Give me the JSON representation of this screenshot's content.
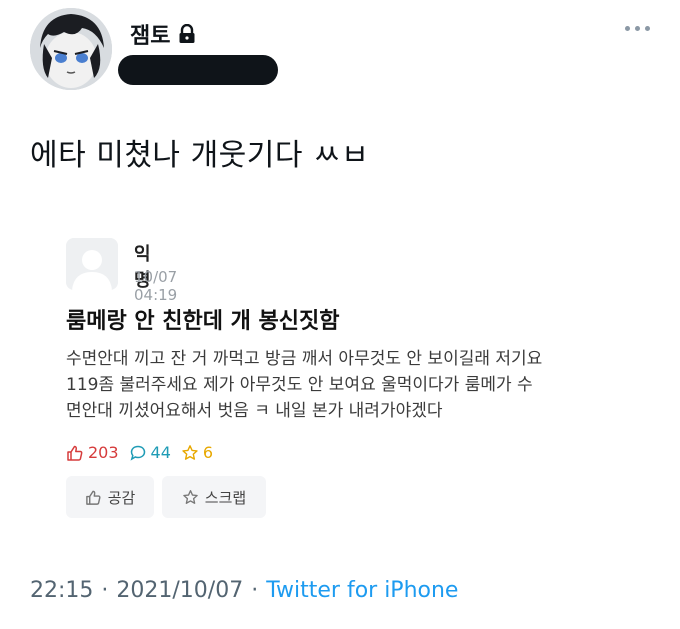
{
  "tweet": {
    "author_name": "잼토",
    "text": "에타 미쳤나 개웃기다 ㅆㅂ",
    "time": "22:15",
    "date": "2021/10/07",
    "source": "Twitter for iPhone",
    "separator": "·"
  },
  "embed": {
    "author": "익명",
    "time": "10/07 04:19",
    "title": "룸메랑 안 친한데 개 봉신짓함",
    "body_lines": [
      "수면안대 끼고 잔 거 까먹고 방금 깨서 아무것도 안 보이길래 저기요",
      "119좀 불러주세요 제가 아무것도 안 보여요 울먹이다가 룸메가 수",
      "면안대 끼셨어요해서 벗음 ㅋ 내일 본가 내려가야겠다"
    ],
    "stats": {
      "likes": "203",
      "comments": "44",
      "scraps": "6"
    },
    "actions": {
      "like_label": "공감",
      "scrap_label": "스크랩"
    }
  },
  "colors": {
    "link": "#1d9bf0",
    "likes": "#d63b3b",
    "comments": "#1e9bb5",
    "scraps": "#e8a800"
  }
}
